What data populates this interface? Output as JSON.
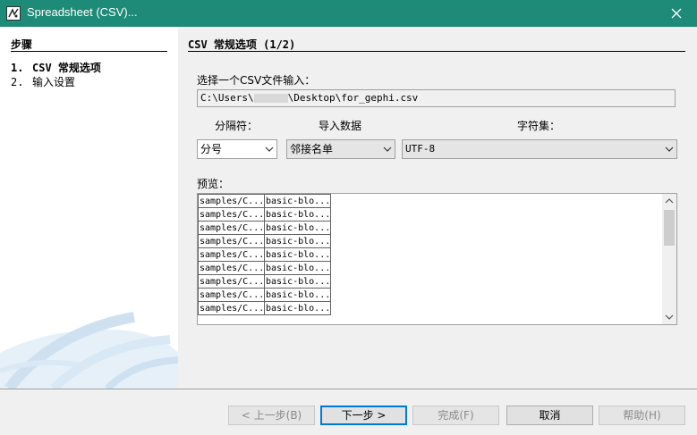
{
  "window": {
    "title": "Spreadsheet (CSV)..."
  },
  "sidebar": {
    "header": "步骤",
    "steps": [
      {
        "num": "1.",
        "label": "CSV 常规选项"
      },
      {
        "num": "2.",
        "label": "输入设置"
      }
    ]
  },
  "main": {
    "header": "CSV 常规选项 (1/2)",
    "file_label": "选择一个CSV文件输入：",
    "file_path_prefix": "C:\\Users\\",
    "file_path_suffix": "\\Desktop\\for_gephi.csv",
    "separator_label": "分隔符：",
    "import_label": "导入数据",
    "charset_label": "字符集：",
    "separator_value": "分号",
    "import_value": "邻接名单",
    "charset_value": "UTF-8",
    "preview_label": "预览：",
    "preview_rows": [
      [
        "samples/C...",
        "basic-blo..."
      ],
      [
        "samples/C...",
        "basic-blo..."
      ],
      [
        "samples/C...",
        "basic-blo..."
      ],
      [
        "samples/C...",
        "basic-blo..."
      ],
      [
        "samples/C...",
        "basic-blo..."
      ],
      [
        "samples/C...",
        "basic-blo..."
      ],
      [
        "samples/C...",
        "basic-blo..."
      ],
      [
        "samples/C...",
        "basic-blo..."
      ],
      [
        "samples/C...",
        "basic-blo..."
      ]
    ]
  },
  "buttons": {
    "back": "< 上一步(B)",
    "next": "下一步 >",
    "finish": "完成(F)",
    "cancel": "取消",
    "help": "帮助(H)"
  }
}
